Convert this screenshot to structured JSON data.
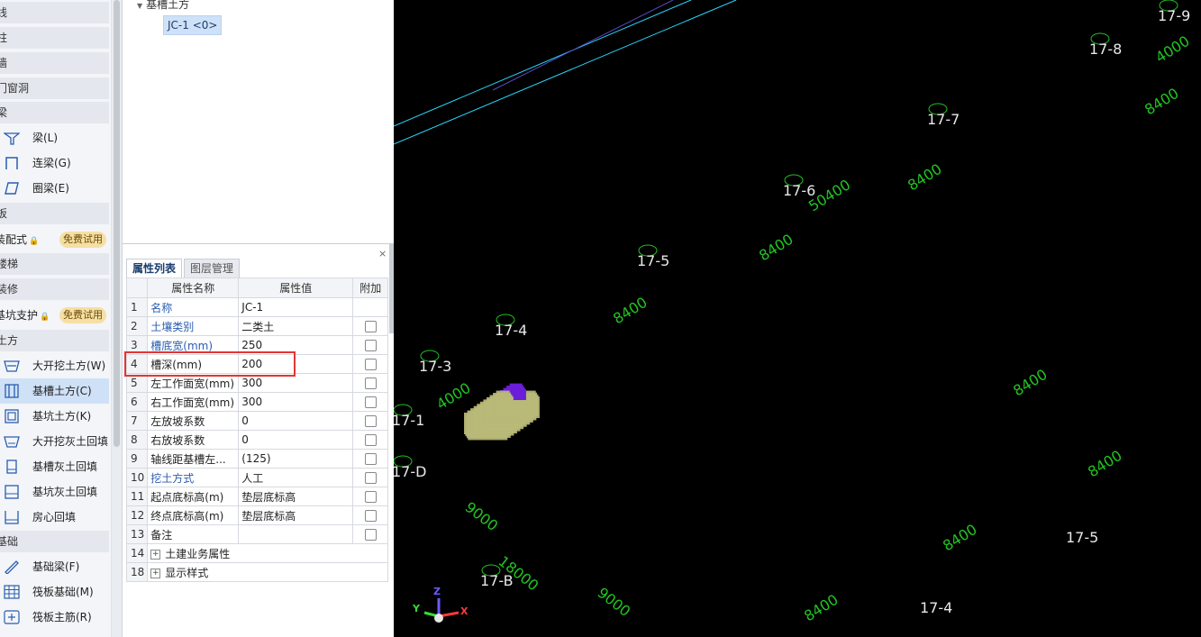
{
  "left_panel": {
    "sections": [
      "线",
      "柱",
      "墙",
      "门窗洞",
      "梁",
      "板",
      "装配式",
      "楼梯",
      "装修",
      "基坑支护",
      "土方",
      "基础"
    ],
    "tools": {
      "beam": "梁(L)",
      "link_beam": "连梁(G)",
      "ring_beam": "圈梁(E)",
      "open_excavation": "大开挖土方(W)",
      "trench_earthwork": "基槽土方(C)",
      "pit_earthwork": "基坑土方(K)",
      "open_backfill": "大开挖灰土回填",
      "trench_backfill": "基槽灰土回填",
      "pit_backfill": "基坑灰土回填",
      "room_backfill": "房心回填",
      "foundation_beam": "基础梁(F)",
      "raft_foundation": "筏板基础(M)",
      "raft_rebar": "筏板主筋(R)"
    },
    "free_trial_badge": "免费试用"
  },
  "tree": {
    "parent": "基槽土方",
    "child": "JC-1 <0>"
  },
  "properties": {
    "close": "×",
    "tabs": [
      "属性列表",
      "图层管理"
    ],
    "headers": [
      "属性名称",
      "属性值",
      "附加"
    ],
    "rows": [
      {
        "num": "1",
        "name": "名称",
        "value": "JC-1"
      },
      {
        "num": "2",
        "name": "土壤类别",
        "value": "二类土"
      },
      {
        "num": "3",
        "name": "槽底宽(mm)",
        "value": "250"
      },
      {
        "num": "4",
        "name": "槽深(mm)",
        "value": "200"
      },
      {
        "num": "5",
        "name": "左工作面宽(mm)",
        "value": "300"
      },
      {
        "num": "6",
        "name": "右工作面宽(mm)",
        "value": "300"
      },
      {
        "num": "7",
        "name": "左放坡系数",
        "value": "0"
      },
      {
        "num": "8",
        "name": "右放坡系数",
        "value": "0"
      },
      {
        "num": "9",
        "name": "轴线距基槽左...",
        "value": "(125)"
      },
      {
        "num": "10",
        "name": "挖土方式",
        "value": "人工"
      },
      {
        "num": "11",
        "name": "起点底标高(m)",
        "value": "垫层底标高"
      },
      {
        "num": "12",
        "name": "终点底标高(m)",
        "value": "垫层底标高"
      },
      {
        "num": "13",
        "name": "备注",
        "value": ""
      },
      {
        "num": "14",
        "name": "土建业务属性",
        "value": ""
      },
      {
        "num": "18",
        "name": "显示样式",
        "value": ""
      }
    ]
  },
  "viewport": {
    "axis_labels": [
      "17-9",
      "17-8",
      "17-7",
      "17-6",
      "17-5",
      "17-4",
      "17-3",
      "17-1",
      "17-D",
      "17-B"
    ],
    "axis_labels_bottom": [
      "17-5",
      "17-4"
    ],
    "dimensions": [
      "50400",
      "8400",
      "8400",
      "8400",
      "8400",
      "8400",
      "4000",
      "4000",
      "9000",
      "18000",
      "9000",
      "8400",
      "8400",
      "8400"
    ],
    "gizmo": {
      "z": "Z",
      "y": "Y",
      "x": "X"
    },
    "colors": {
      "beam": "#3ec93e",
      "footing": "#b9b978",
      "column": "#6a1ed8",
      "grid": "#19d8ff",
      "dim": "#22c322"
    }
  }
}
